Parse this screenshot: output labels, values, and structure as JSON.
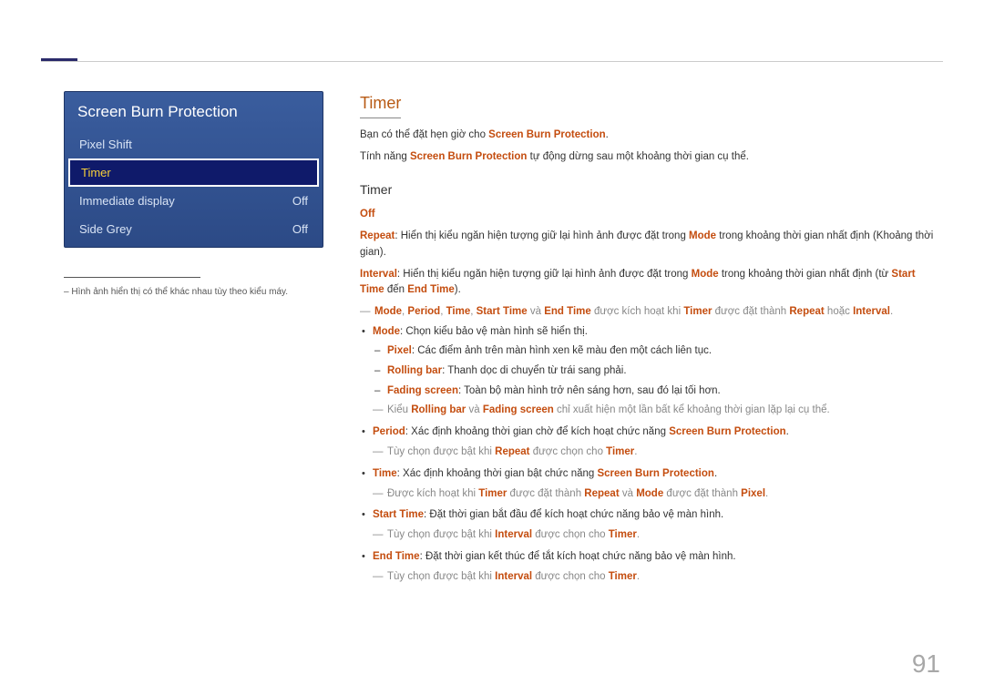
{
  "page_number": "91",
  "menu": {
    "title": "Screen Burn Protection",
    "items": [
      {
        "label": "Pixel Shift",
        "value": ""
      },
      {
        "label": "Timer",
        "value": ""
      },
      {
        "label": "Immediate display",
        "value": "Off"
      },
      {
        "label": "Side Grey",
        "value": "Off"
      }
    ],
    "selected_index": 1
  },
  "left_footnote_prefix": "– ",
  "left_footnote": "Hình ảnh hiển thị có thể khác nhau tùy theo kiểu máy.",
  "content": {
    "section_title": "Timer",
    "intro_1_a": "Bạn có thể đặt hẹn giờ cho ",
    "intro_1_hl": "Screen Burn Protection",
    "intro_1_b": ".",
    "intro_2_a": "Tính năng ",
    "intro_2_hl": "Screen Burn Protection",
    "intro_2_b": " tự động dừng sau một khoảng thời gian cụ thể.",
    "subhead": "Timer",
    "off_label": "Off",
    "repeat_a": ": Hiển thị kiểu ngăn hiện tượng giữ lại hình ảnh được đặt trong ",
    "repeat_hl": "Repeat",
    "mode_hl": "Mode",
    "repeat_b": " trong khoảng thời gian nhất định (Khoảng thời gian).",
    "interval_hl": "Interval",
    "interval_a": ": Hiển thị kiểu ngăn hiện tượng giữ lại hình ảnh được đặt trong ",
    "interval_b": " trong khoảng thời gian nhất định (từ ",
    "start_time_hl": "Start Time",
    "den": " đến ",
    "end_time_hl": "End Time",
    "interval_c": ").",
    "note1_prefix": "",
    "note1_parts": {
      "p1": ", ",
      "p2": ", ",
      "p3": ", ",
      "p4": " và ",
      "p5": " được kích hoạt khi ",
      "p6": "Timer",
      "p7": " được đặt thành ",
      "p8": " hoặc ",
      "p9": "."
    },
    "period_hl": "Period",
    "time_hl": "Time",
    "bullet_mode_a": ": Chọn kiểu bảo vệ màn hình sẽ hiển thị.",
    "pixel_hl": "Pixel",
    "pixel_txt": ": Các điểm ảnh trên màn hình xen kẽ màu đen một cách liên tục.",
    "rollingbar_hl": "Rolling bar",
    "rollingbar_txt": ": Thanh dọc di chuyển từ trái sang phải.",
    "fading_hl": "Fading screen",
    "fading_txt": ": Toàn bộ màn hình trở nên sáng hơn, sau đó lại tối hơn.",
    "note_rolling_a": "Kiểu ",
    "note_rolling_b": " và ",
    "note_rolling_c": " chỉ xuất hiện một lần bất kể khoảng thời gian lặp lại cụ thể.",
    "bullet_period_a": ": Xác định khoảng thời gian chờ để kích hoạt chức năng ",
    "sbp_hl": "Screen Burn Protection",
    "note_period": "Tùy chọn được bật khi ",
    "note_period_b": " được chọn cho ",
    "timer_hl": "Timer",
    "bullet_time_a": ": Xác định khoảng thời gian bật chức năng ",
    "note_time_a": "Được kích hoạt khi ",
    "note_time_b": " được đặt thành ",
    "note_time_c": " và ",
    "note_time_d": " được đặt thành ",
    "bullet_start_a": ": Đặt thời gian bắt đầu để kích hoạt chức năng bảo vệ màn hình.",
    "note_interval": "Tùy chọn được bật khi ",
    "note_interval_b": " được chọn cho ",
    "bullet_end_a": ": Đặt thời gian kết thúc để tắt kích hoạt chức năng bảo vệ màn hình."
  }
}
